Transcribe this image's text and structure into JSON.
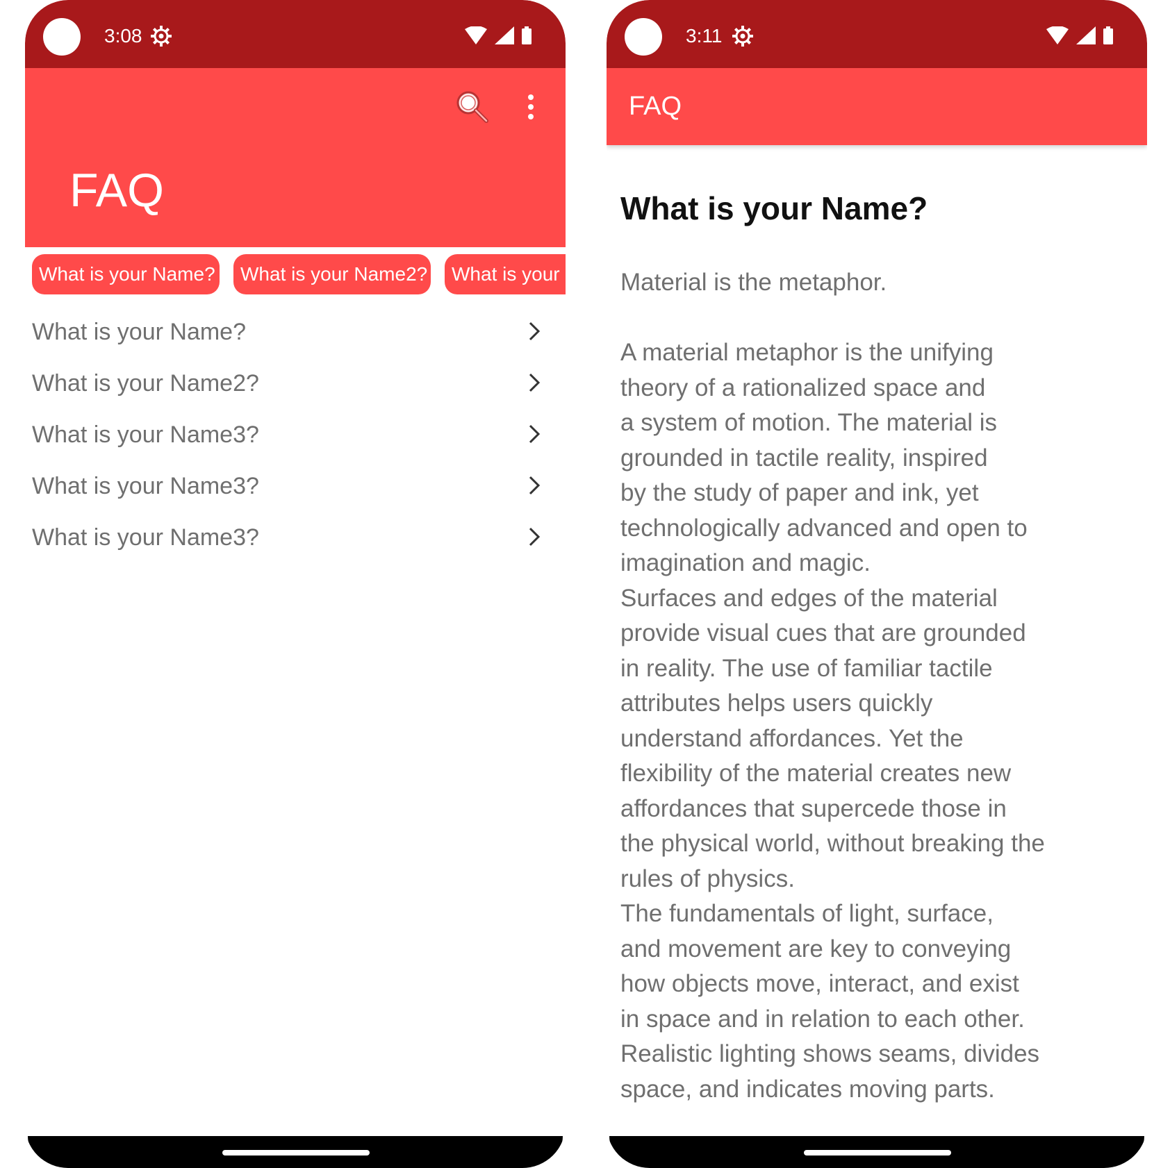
{
  "left_screen": {
    "status": {
      "time": "3:08"
    },
    "appbar": {
      "title": "FAQ",
      "search_icon": "search-icon",
      "more_icon": "more-vert-icon"
    },
    "chips": [
      "What is your Name?",
      "What is your Name2?",
      "What is your"
    ],
    "faq_items": [
      "What is your Name?",
      "What is your Name2?",
      "What is your Name3?",
      "What is your Name3?",
      "What is your Name3?"
    ]
  },
  "right_screen": {
    "status": {
      "time": "3:11"
    },
    "appbar": {
      "title": "FAQ"
    },
    "question": "What is your Name?",
    "answer": "Material is the metaphor.\n\n A material metaphor is the unifying\ntheory of a rationalized space and\na system of motion. The material is\ngrounded in tactile reality, inspired\nby the study of paper and ink, yet\ntechnologically advanced and open to\nimagination and magic.\n Surfaces and edges of the material\nprovide visual cues that are grounded\nin reality. The  use of familiar tactile\nattributes helps users quickly\nunderstand affordances. Yet the\nflexibility of the material creates new\naffordances that supercede those in\nthe physical  world, without breaking the\nrules of physics.\n The fundamentals of light, surface,\nand movement are key to conveying\nhow objects move,  interact, and exist\nin space and in relation to each other.\nRealistic lighting shows  seams, divides\nspace, and indicates moving parts."
  },
  "colors": {
    "status_bar": "#a8191b",
    "app_bar": "#ff4a4a",
    "chip": "#ff4a4a",
    "list_text": "#6f6f6f",
    "title_text": "#111111"
  }
}
